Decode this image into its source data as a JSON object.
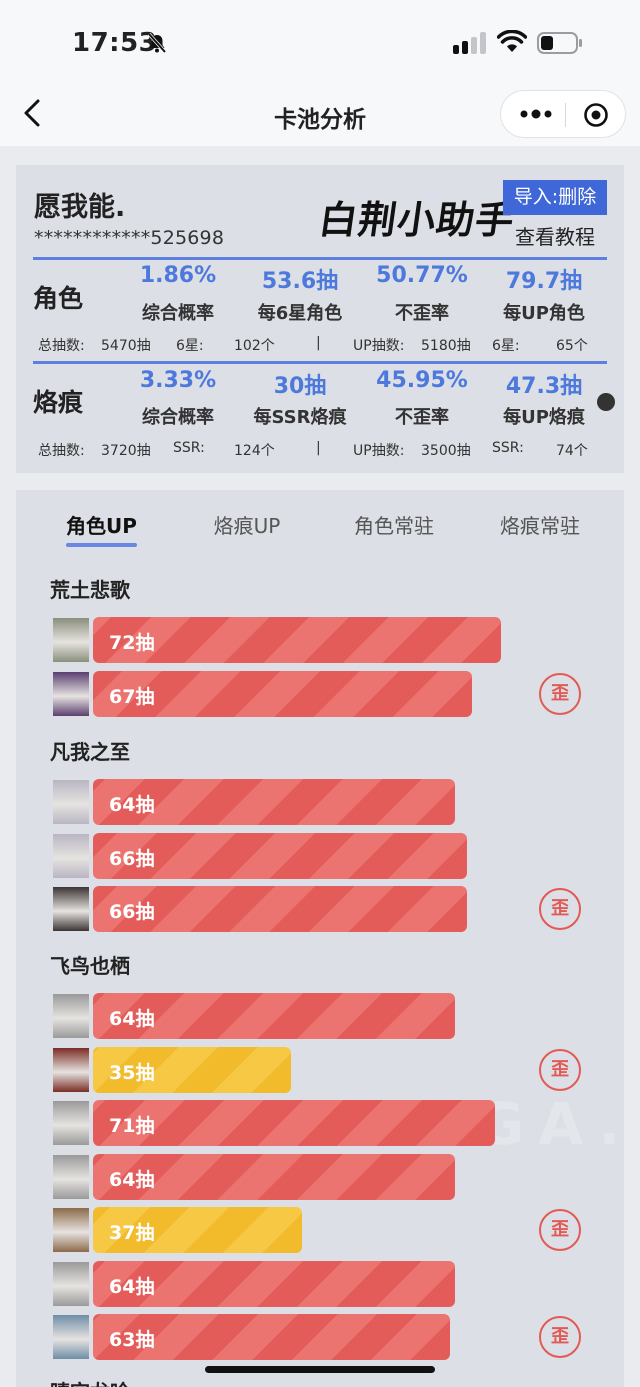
{
  "status_bar": {
    "time": "17:53"
  },
  "nav": {
    "title": "卡池分析"
  },
  "profile": {
    "name": "愿我能.",
    "uid": "************525698",
    "logo_text": "白荆小助手",
    "import_label": "导入:删除",
    "tutorial_label": "查看教程"
  },
  "sections": [
    {
      "name": "角色",
      "stats": [
        {
          "value": "1.86%",
          "label": "综合概率"
        },
        {
          "value": "53.6抽",
          "label": "每6星角色"
        },
        {
          "value": "50.77%",
          "label": "不歪率"
        },
        {
          "value": "79.7抽",
          "label": "每UP角色"
        }
      ],
      "sub": [
        "总抽数:",
        "5470抽",
        "6星:",
        "102个",
        "|",
        "UP抽数:",
        "5180抽",
        "6星:",
        "65个"
      ]
    },
    {
      "name": "烙痕",
      "stats": [
        {
          "value": "3.33%",
          "label": "综合概率"
        },
        {
          "value": "30抽",
          "label": "每SSR烙痕"
        },
        {
          "value": "45.95%",
          "label": "不歪率"
        },
        {
          "value": "47.3抽",
          "label": "每UP烙痕"
        }
      ],
      "sub": [
        "总抽数:",
        "3720抽",
        "SSR:",
        "124个",
        "|",
        "UP抽数:",
        "3500抽",
        "SSR:",
        "74个"
      ]
    }
  ],
  "tabs": [
    "角色UP",
    "烙痕UP",
    "角色常驻",
    "烙痕常驻"
  ],
  "wai_label": "歪",
  "groups": [
    {
      "name": "荒土悲歌",
      "rows": [
        {
          "pulls": 72,
          "label": "72抽",
          "color": "red",
          "wai": false,
          "avatar": "#8a8f7c"
        },
        {
          "pulls": 67,
          "label": "67抽",
          "color": "red",
          "wai": true,
          "avatar": "#5a3f6f"
        }
      ]
    },
    {
      "name": "凡我之至",
      "rows": [
        {
          "pulls": 64,
          "label": "64抽",
          "color": "red",
          "wai": false,
          "avatar": "#b9b6c4"
        },
        {
          "pulls": 66,
          "label": "66抽",
          "color": "red",
          "wai": false,
          "avatar": "#b9b6c4"
        },
        {
          "pulls": 66,
          "label": "66抽",
          "color": "red",
          "wai": true,
          "avatar": "#3b3433"
        }
      ]
    },
    {
      "name": "飞鸟也栖",
      "rows": [
        {
          "pulls": 64,
          "label": "64抽",
          "color": "red",
          "wai": false,
          "avatar": "#9a9a9a"
        },
        {
          "pulls": 35,
          "label": "35抽",
          "color": "yellow",
          "wai": true,
          "avatar": "#7a2d24"
        },
        {
          "pulls": 71,
          "label": "71抽",
          "color": "red",
          "wai": false,
          "avatar": "#9a9a9a"
        },
        {
          "pulls": 64,
          "label": "64抽",
          "color": "red",
          "wai": false,
          "avatar": "#9a9a9a"
        },
        {
          "pulls": 37,
          "label": "37抽",
          "color": "yellow",
          "wai": true,
          "avatar": "#8c6a4a"
        },
        {
          "pulls": 64,
          "label": "64抽",
          "color": "red",
          "wai": false,
          "avatar": "#9a9a9a"
        },
        {
          "pulls": 63,
          "label": "63抽",
          "color": "red",
          "wai": true,
          "avatar": "#6f8ea8"
        }
      ]
    }
  ],
  "next_group": "晴空龙吟",
  "watermark": "BBS.NGA.CN",
  "colors": {
    "accent": "#4d79dd",
    "bar_red": "#e45c5a",
    "bar_yellow": "#f2bb2c",
    "wai": "#e15a55"
  }
}
